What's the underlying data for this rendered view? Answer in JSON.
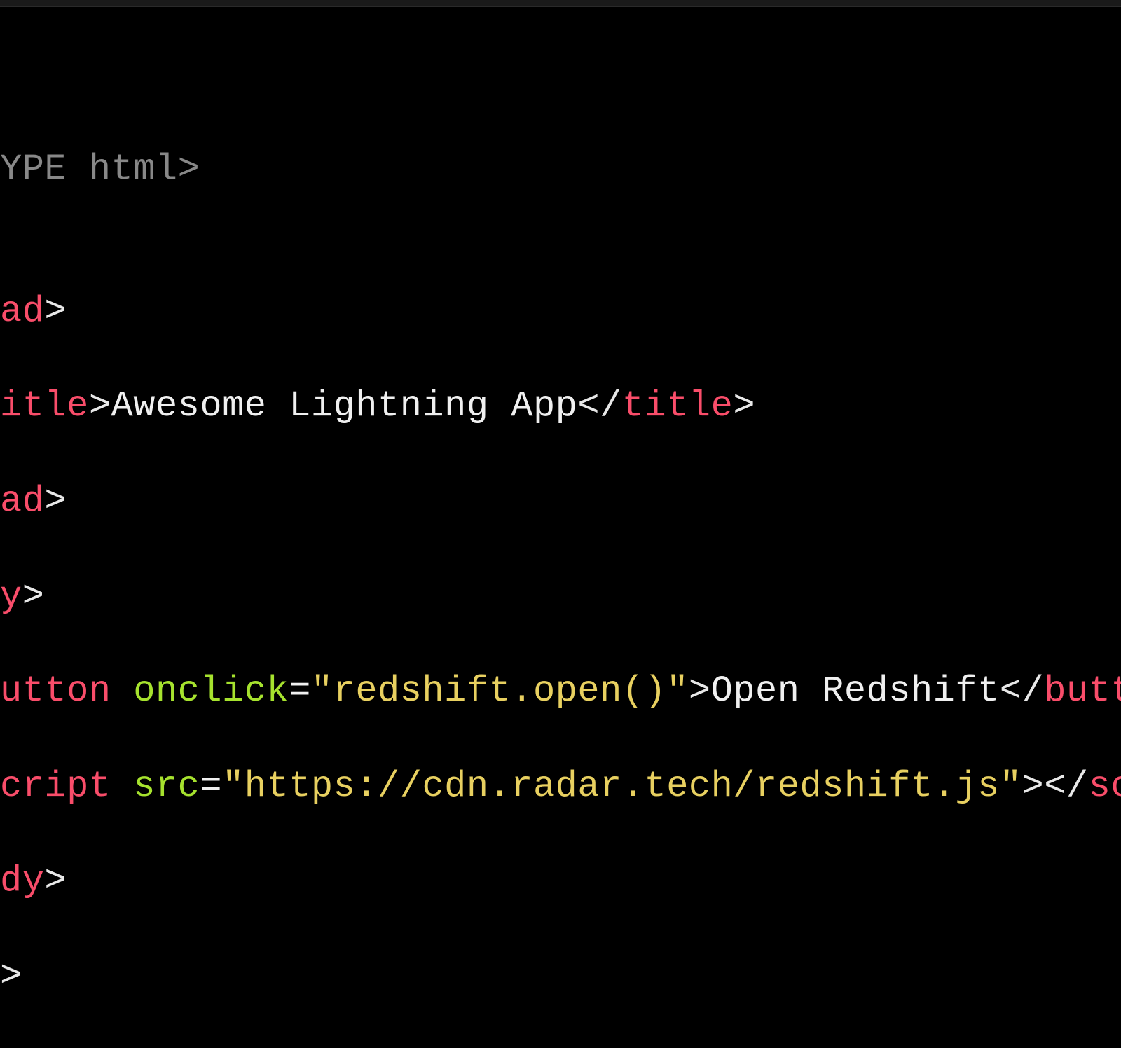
{
  "editor": {
    "lines": {
      "l1_doctype": "YPE html>",
      "l3_head_open_pre": "ad",
      "l3_gt": ">",
      "l4_title_open_pre": "itle",
      "l4_title_text": "Awesome Lightning App",
      "l4_title_close": "title",
      "l5_head_close_pre": "ad",
      "l6_body_open_pre": "y",
      "l7_button_tag": "utton",
      "l7_onclick_attr": "onclick",
      "l7_onclick_val": "\"redshift.open()\"",
      "l7_button_text": "Open Redshift",
      "l7_button_close": "button",
      "l8_script_tag": "cript",
      "l8_src_attr": "src",
      "l8_src_val": "\"https://cdn.radar.tech/redshift.js\"",
      "l8_script_close": "script",
      "l9_body_close_pre": "dy",
      "l10_html_close": ">"
    }
  }
}
